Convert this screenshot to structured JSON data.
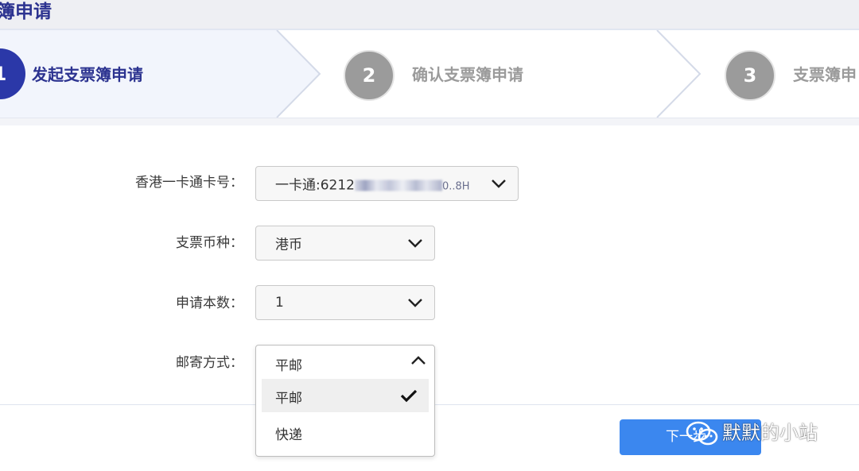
{
  "page": {
    "title": "簿申请"
  },
  "steps": [
    {
      "number": "1",
      "label": "发起支票簿申请",
      "state": "active"
    },
    {
      "number": "2",
      "label": "确认支票簿申请",
      "state": "pending"
    },
    {
      "number": "3",
      "label": "支票簿申",
      "state": "pending"
    }
  ],
  "form": {
    "card": {
      "label": "香港一卡通卡号：",
      "value_prefix": "一卡通:6212",
      "value_suffix": "0..8H",
      "icon": "chevron-down-icon"
    },
    "currency": {
      "label": "支票币种：",
      "value": "港币",
      "icon": "chevron-down-icon"
    },
    "count": {
      "label": "申请本数：",
      "value": "1",
      "icon": "chevron-down-icon"
    },
    "delivery": {
      "label": "邮寄方式：",
      "value": "平邮",
      "icon": "chevron-up-icon",
      "options": [
        {
          "label": "平邮",
          "selected": true,
          "icon": "check-icon"
        },
        {
          "label": "快递",
          "selected": false
        }
      ]
    }
  },
  "footer": {
    "next_label": "下一步"
  },
  "watermark": {
    "text": "默默的小站",
    "icon": "wechat-icon"
  },
  "colors": {
    "primary": "#2c3390",
    "step_done": "#2b38a8",
    "step_pending": "#9b9b9b",
    "button": "#3b87ef"
  }
}
